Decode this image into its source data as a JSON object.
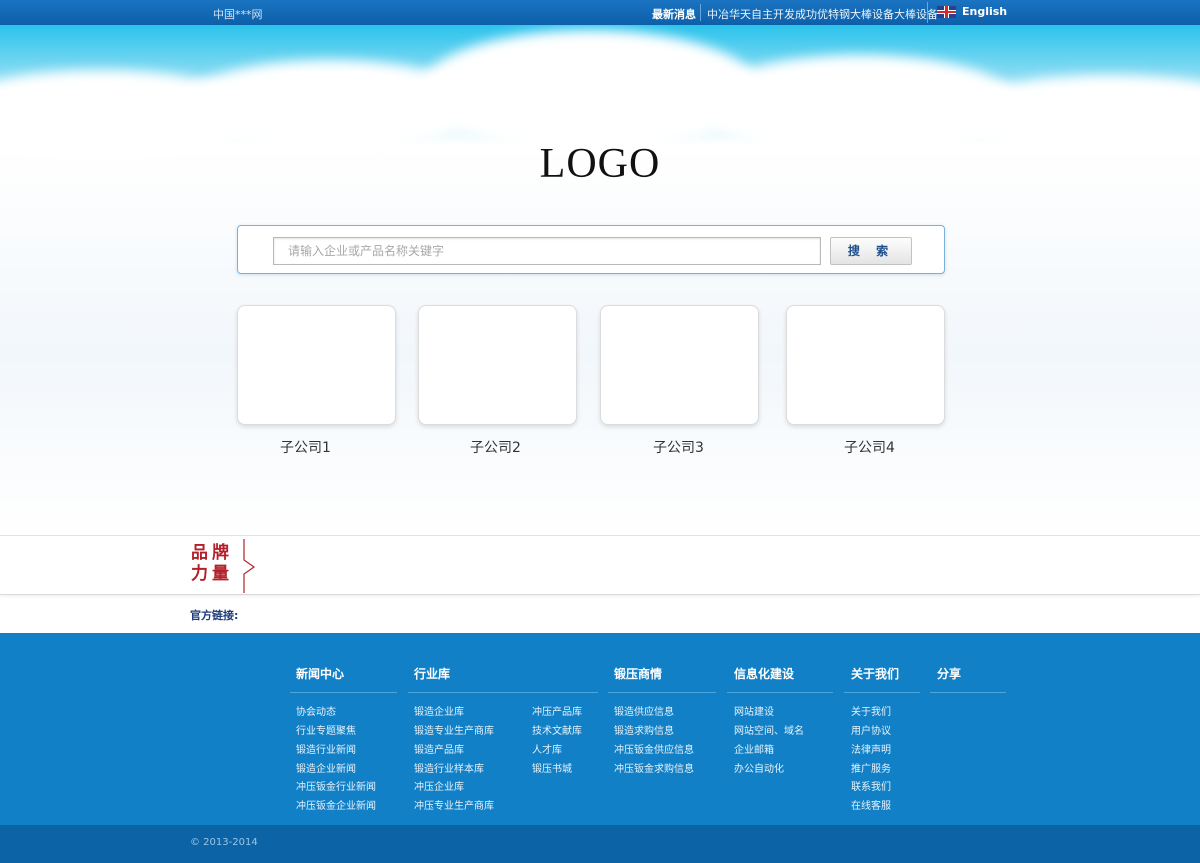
{
  "topbar": {
    "site_name": "中国***网",
    "news_title": "最新消息",
    "news_text": "中冶华天自主开发成功优特钢大棒设备大棒设备",
    "language_label": "English"
  },
  "hero": {
    "logo_text": "LOGO",
    "search": {
      "placeholder": "请输入企业或产品名称关键字",
      "button_label": "搜 索"
    },
    "subsidiaries": [
      "子公司1",
      "子公司2",
      "子公司3",
      "子公司4"
    ]
  },
  "brand": {
    "title_line1": "品牌",
    "title_line2": "力量"
  },
  "official_links_label": "官方链接:",
  "footer": {
    "columns": {
      "news": {
        "heading": "新闻中心",
        "items": [
          "协会动态",
          "行业专题聚焦",
          "锻造行业新闻",
          "锻造企业新闻",
          "冲压钣金行业新闻",
          "冲压钣金企业新闻"
        ]
      },
      "industry": {
        "heading": "行业库",
        "items_left": [
          "锻造企业库",
          "锻造专业生产商库",
          "锻造产品库",
          "锻造行业样本库",
          "冲压企业库",
          "冲压专业生产商库"
        ],
        "items_right": [
          "冲压产品库",
          "技术文献库",
          "人才库",
          "锻压书城"
        ]
      },
      "trade": {
        "heading": "锻压商情",
        "items": [
          "锻造供应信息",
          "锻造求购信息",
          "冲压钣金供应信息",
          "冲压钣金求购信息"
        ]
      },
      "it": {
        "heading": "信息化建设",
        "items": [
          "网站建设",
          "网站空间、域名",
          "企业邮箱",
          "办公自动化"
        ]
      },
      "about": {
        "heading": "关于我们",
        "items": [
          "关于我们",
          "用户协议",
          "法律声明",
          "推广服务",
          "联系我们",
          "在线客服"
        ]
      },
      "share": {
        "heading": "分享"
      }
    },
    "copyright": "© 2013-2014"
  },
  "colors": {
    "topbar": "#0d5fa8",
    "footer": "#1180c7",
    "brand_red": "#b3202a"
  }
}
